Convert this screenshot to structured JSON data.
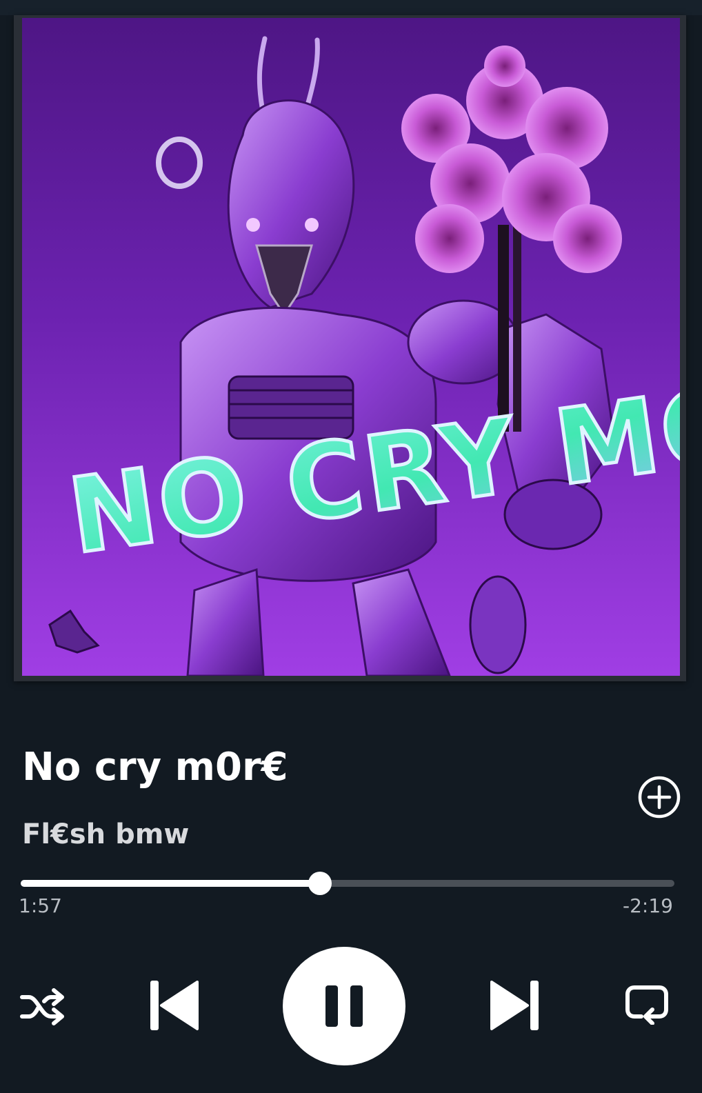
{
  "track": {
    "title": "No cry m0r€",
    "artist": "Fl€sh bmw",
    "artwork_text": "NO CRY MORE"
  },
  "playback": {
    "elapsed": "1:57",
    "remaining": "-2:19",
    "progress": 0.458,
    "state": "playing"
  },
  "controls": {
    "shuffle_icon": "shuffle-icon",
    "previous_icon": "skip-previous-icon",
    "pause_icon": "pause-icon",
    "next_icon": "skip-next-icon",
    "repeat_icon": "repeat-icon",
    "add_icon": "add-circle-icon"
  },
  "colors": {
    "background": "#121a22",
    "accent": "#ffffff",
    "track_bg": "#4a5057",
    "artwork_purple": "#7a2bc4"
  }
}
